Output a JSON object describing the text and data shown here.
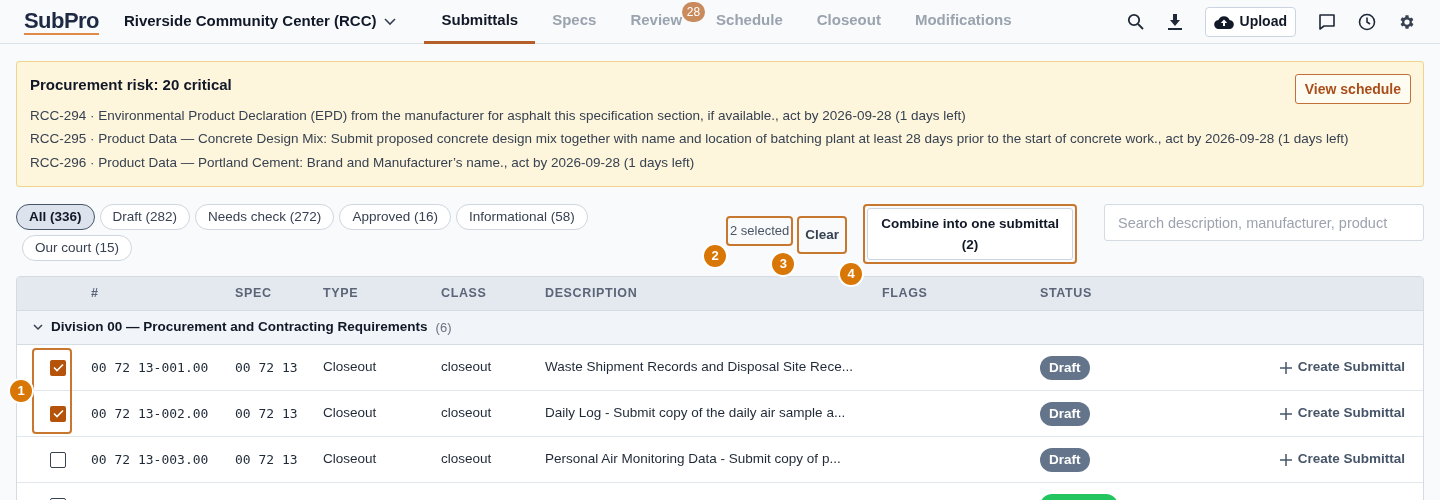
{
  "header": {
    "logo": "SubPro",
    "project": "Riverside Community Center (RCC)",
    "tabs": [
      {
        "label": "Submittals",
        "selected": true
      },
      {
        "label": "Specs",
        "selected": false
      },
      {
        "label": "Review",
        "selected": false,
        "badge": "28"
      },
      {
        "label": "Schedule",
        "selected": false
      },
      {
        "label": "Closeout",
        "selected": false
      },
      {
        "label": "Modifications",
        "selected": false
      }
    ],
    "upload": "Upload"
  },
  "risk": {
    "title": "Procurement risk: 20 critical",
    "action": "View schedule",
    "items": [
      "RCC-294 · Environmental Product Declaration (EPD) from the manufacturer for asphalt this specification section, if available., act by 2026-09-28 (1 days left)",
      "RCC-295 · Product Data — Concrete Design Mix: Submit proposed concrete design mix together with name and location of batching plant at least 28 days prior to the start of concrete work., act by 2026-09-28 (1 days left)",
      "RCC-296 · Product Data — Portland Cement: Brand and Manufacturer’s name., act by 2026-09-28 (1 days left)"
    ]
  },
  "filters": [
    {
      "label": "All (336)",
      "selected": true
    },
    {
      "label": "Draft (282)",
      "selected": false
    },
    {
      "label": "Needs check (272)",
      "selected": false
    },
    {
      "label": "Approved (16)",
      "selected": false
    },
    {
      "label": "Informational (58)",
      "selected": false
    },
    {
      "label": "Our court (15)",
      "selected": false
    }
  ],
  "selection": {
    "count": "2 selected",
    "count_callout": "2",
    "clear": "Clear",
    "clear_callout": "3",
    "combine": "Combine into one submittal",
    "combine_count": "(2)",
    "combine_callout": "4"
  },
  "search": {
    "placeholder": "Search description, manufacturer, product"
  },
  "table": {
    "columns": [
      "#",
      "SPEC",
      "TYPE",
      "CLASS",
      "DESCRIPTION",
      "FLAGS",
      "STATUS"
    ],
    "checkbox_callout": "1",
    "group": {
      "title": "Division 00 — Procurement and Contracting Requirements",
      "count": "(6)",
      "expanded": true
    },
    "rows": [
      {
        "checked": true,
        "number": "00 72 13-001.00",
        "spec": "00 72 13",
        "type": "Closeout",
        "class": "closeout",
        "description": "Waste Shipment Records and Disposal Site Rece...",
        "status": "Draft",
        "color": "#64748b",
        "action": "Create Submittal"
      },
      {
        "checked": true,
        "number": "00 72 13-002.00",
        "spec": "00 72 13",
        "type": "Closeout",
        "class": "closeout",
        "description": "Daily Log - Submit copy of the daily air sample a...",
        "status": "Draft",
        "color": "#64748b",
        "action": "Create Submittal"
      },
      {
        "checked": false,
        "number": "00 72 13-003.00",
        "spec": "00 72 13",
        "type": "Closeout",
        "class": "closeout",
        "description": "Personal Air Monitoring Data - Submit copy of p...",
        "status": "Draft",
        "color": "#64748b",
        "action": "Create Submittal"
      },
      {
        "checked": false,
        "color": "#22c55e"
      }
    ]
  }
}
